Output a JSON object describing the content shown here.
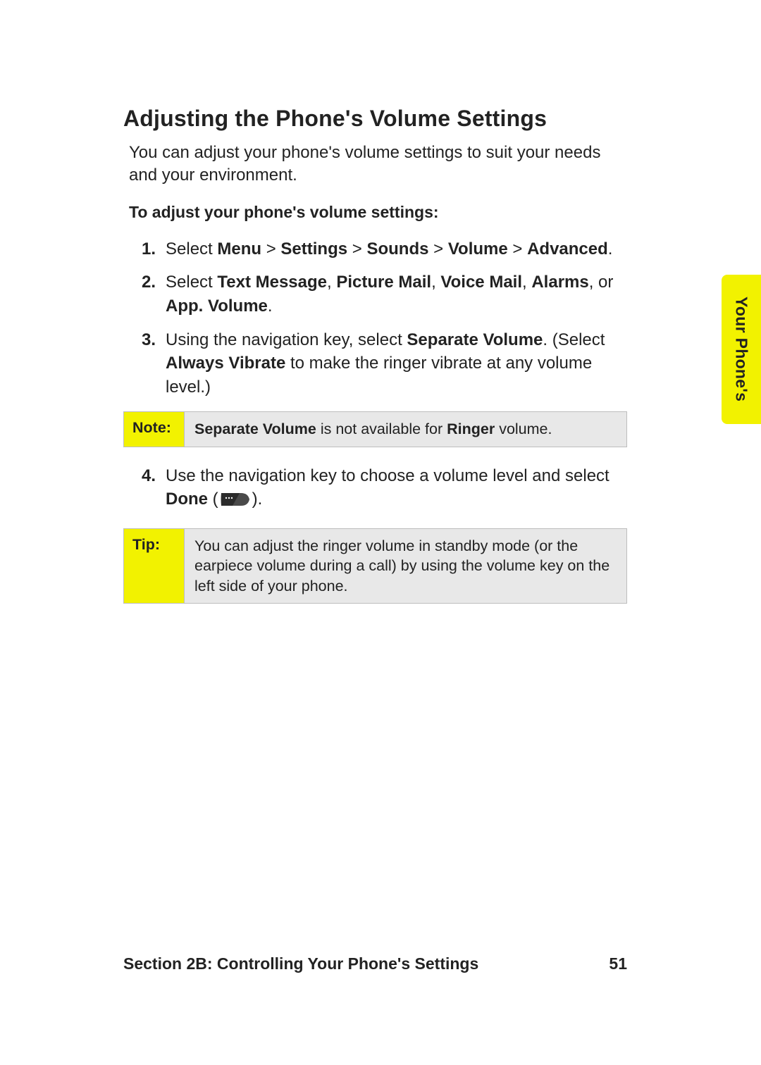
{
  "title": "Adjusting the Phone's Volume Settings",
  "intro": "You can adjust your phone's volume settings to suit your needs and your environment.",
  "subhead": "To adjust your phone's volume settings:",
  "steps": {
    "s1": {
      "pre": "Select ",
      "path_parts": [
        "Menu",
        "Settings",
        "Sounds",
        "Volume",
        "Advanced"
      ],
      "sep": " > ",
      "post": "."
    },
    "s2": {
      "pre": "Select ",
      "opts": [
        "Text Message",
        "Picture Mail",
        "Voice Mail",
        "Alarms"
      ],
      "or": ", or ",
      "last": "App. Volume",
      "post": "."
    },
    "s3": {
      "pre": "Using the navigation key, select ",
      "sv": "Separate Volume",
      "mid1": ". (Select ",
      "av": "Always Vibrate",
      "mid2": " to make the ringer vibrate at any volume level.)"
    },
    "s4": {
      "pre": "Use the navigation key to choose a volume level and select ",
      "done": "Done",
      "post_open": " (",
      "post_close": ")."
    }
  },
  "note": {
    "label": "Note:",
    "b1": "Separate Volume",
    "mid": " is not available for ",
    "b2": "Ringer",
    "post": " volume."
  },
  "tip": {
    "label": "Tip:",
    "text": "You can adjust the ringer volume in standby mode (or the earpiece volume during a call) by using the volume key on the left side of your phone."
  },
  "side_tab": "Your Phone's",
  "footer": {
    "section": "Section 2B: Controlling Your Phone's Settings",
    "page": "51"
  }
}
